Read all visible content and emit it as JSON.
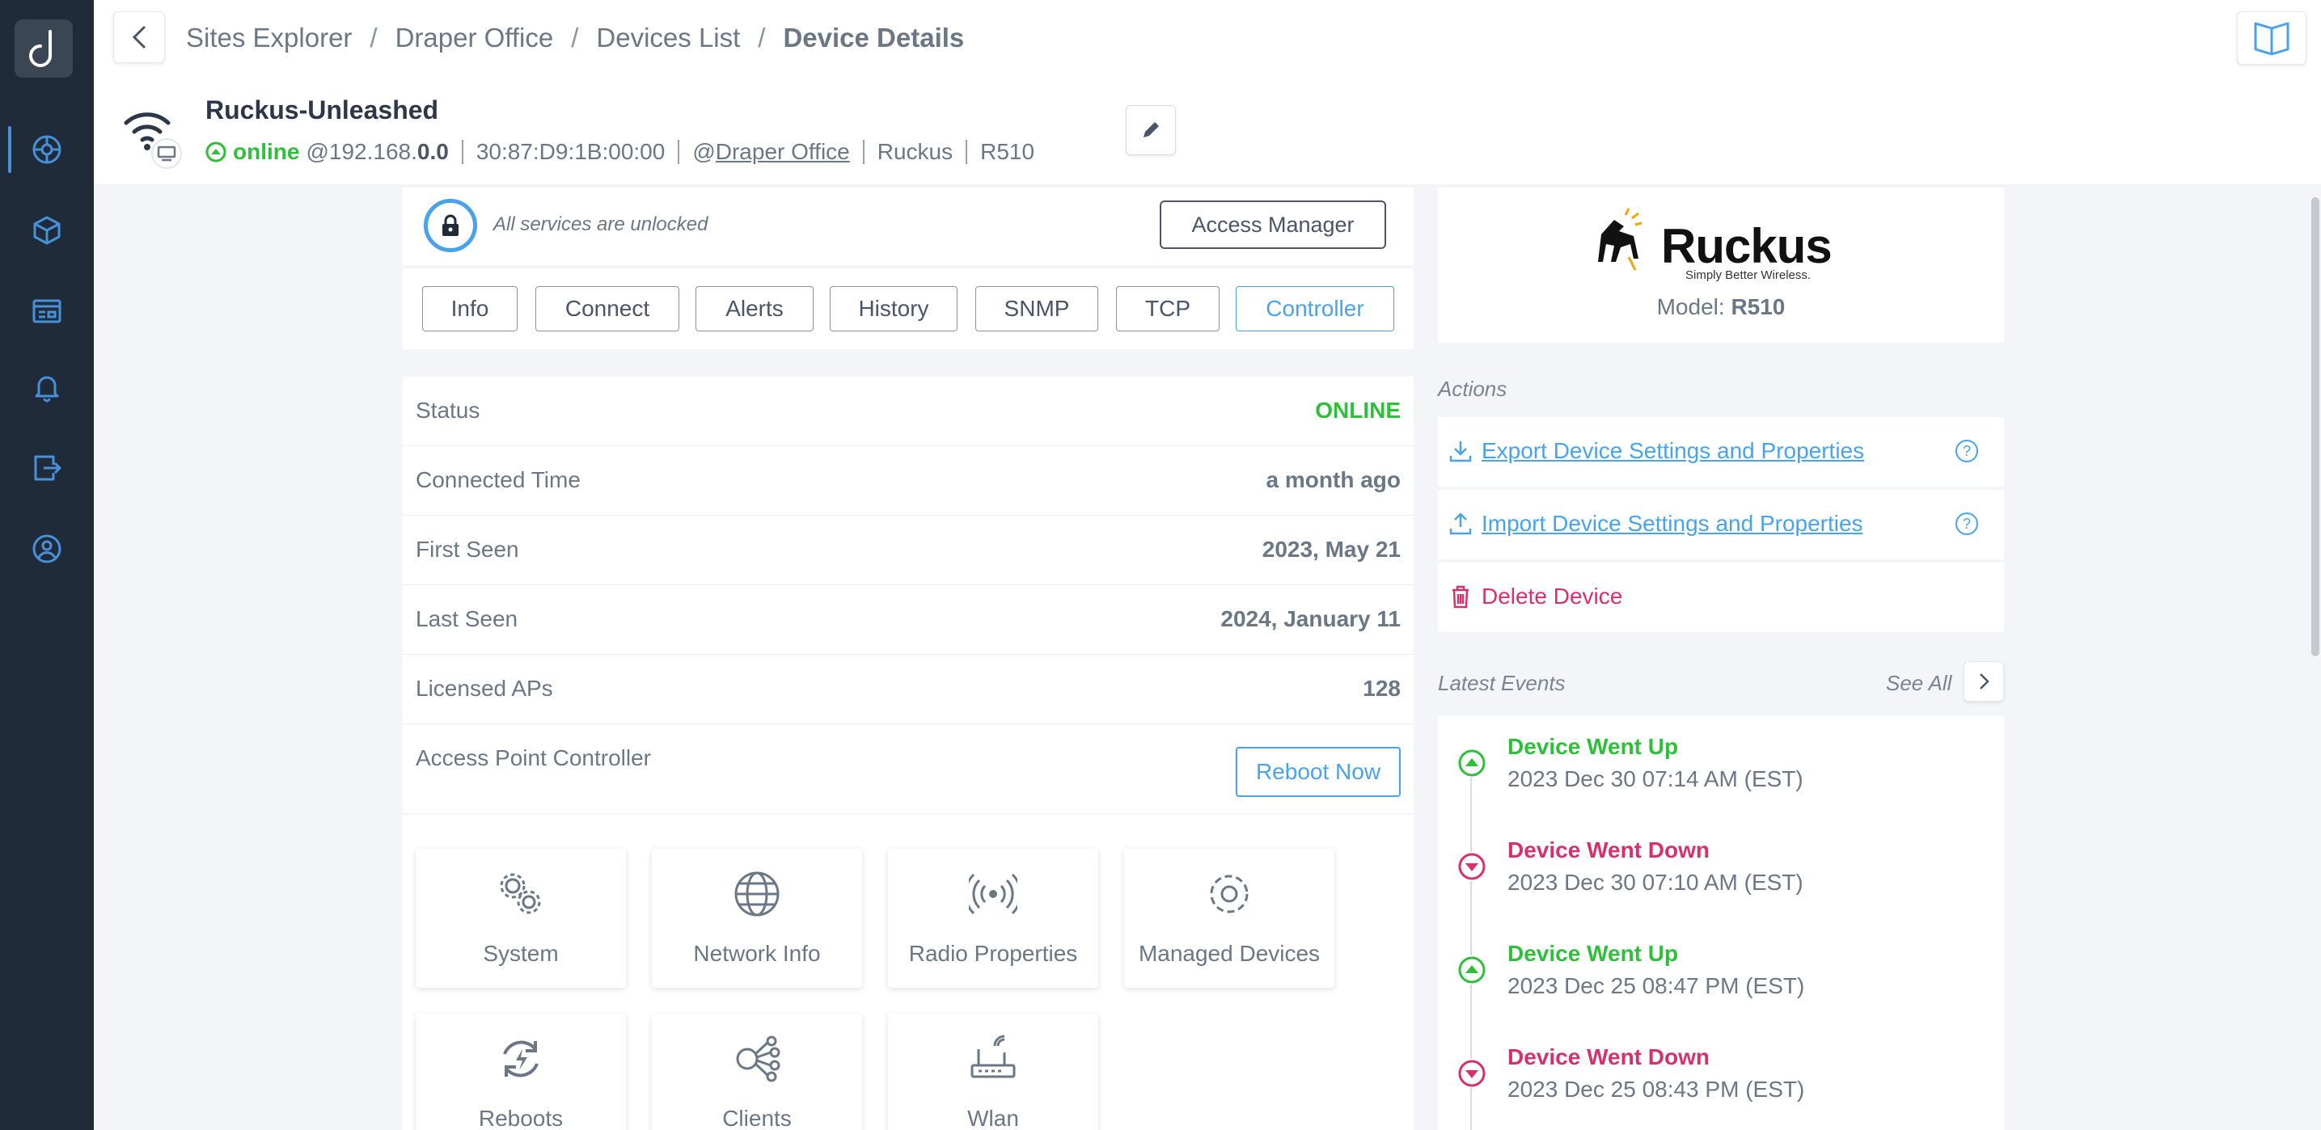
{
  "sidebar": {
    "items": [
      {
        "name": "sites-icon"
      },
      {
        "name": "devices-icon"
      },
      {
        "name": "dashboard-icon"
      },
      {
        "name": "alerts-icon"
      },
      {
        "name": "reports-icon"
      },
      {
        "name": "account-icon"
      }
    ]
  },
  "breadcrumb": {
    "items": [
      "Sites Explorer",
      "Draper Office",
      "Devices List"
    ],
    "current": "Device Details",
    "separator": "/"
  },
  "device": {
    "name": "Ruckus-Unleashed",
    "status": "online",
    "ip_prefix": "@192.168.",
    "ip_suffix": "0.0",
    "mac": "30:87:D9:1B:00:00",
    "site_prefix": "@",
    "site": "Draper Office",
    "vendor": "Ruckus",
    "model": "R510"
  },
  "lock": {
    "text": "All services are unlocked",
    "access_manager_label": "Access Manager"
  },
  "tabs": [
    {
      "label": "Info",
      "active": false
    },
    {
      "label": "Connect",
      "active": false
    },
    {
      "label": "Alerts",
      "active": false
    },
    {
      "label": "History",
      "active": false
    },
    {
      "label": "SNMP",
      "active": false
    },
    {
      "label": "TCP",
      "active": false
    },
    {
      "label": "Controller",
      "active": true
    }
  ],
  "details": {
    "status": {
      "label": "Status",
      "value": "ONLINE"
    },
    "connected_time": {
      "label": "Connected Time",
      "value": "a month ago"
    },
    "first_seen": {
      "label": "First Seen",
      "value": "2023, May 21"
    },
    "last_seen": {
      "label": "Last Seen",
      "value": "2024, January 11"
    },
    "licensed_aps": {
      "label": "Licensed APs",
      "value": "128"
    },
    "ap_controller": {
      "label": "Access Point Controller",
      "button": "Reboot Now"
    }
  },
  "tiles": [
    {
      "label": "System",
      "icon": "gears-icon"
    },
    {
      "label": "Network Info",
      "icon": "globe-icon"
    },
    {
      "label": "Radio Properties",
      "icon": "radio-icon"
    },
    {
      "label": "Managed Devices",
      "icon": "gear-icon"
    },
    {
      "label": "Reboots",
      "icon": "reboot-icon"
    },
    {
      "label": "Clients",
      "icon": "clients-icon"
    },
    {
      "label": "Wlan",
      "icon": "router-icon"
    }
  ],
  "brand": {
    "logo_text": "Ruckus",
    "tagline": "Simply Better Wireless.",
    "model_label": "Model:",
    "model_value": "R510"
  },
  "actions": {
    "title": "Actions",
    "export": "Export Device Settings and Properties",
    "import": "Import Device Settings and Properties",
    "delete": "Delete Device",
    "help_glyph": "?"
  },
  "events": {
    "title": "Latest Events",
    "see_all": "See All",
    "items": [
      {
        "title": "Device Went Up",
        "time": "2023 Dec 30 07:14 AM (EST)",
        "kind": "up"
      },
      {
        "title": "Device Went Down",
        "time": "2023 Dec 30 07:10 AM (EST)",
        "kind": "down"
      },
      {
        "title": "Device Went Up",
        "time": "2023 Dec 25 08:47 PM (EST)",
        "kind": "up"
      },
      {
        "title": "Device Went Down",
        "time": "2023 Dec 25 08:43 PM (EST)",
        "kind": "down"
      }
    ]
  },
  "colors": {
    "sidebar_bg": "#1f2b38",
    "accent": "#4aa3e8",
    "online_green": "#2fbf3a",
    "danger_pink": "#d6306e"
  }
}
